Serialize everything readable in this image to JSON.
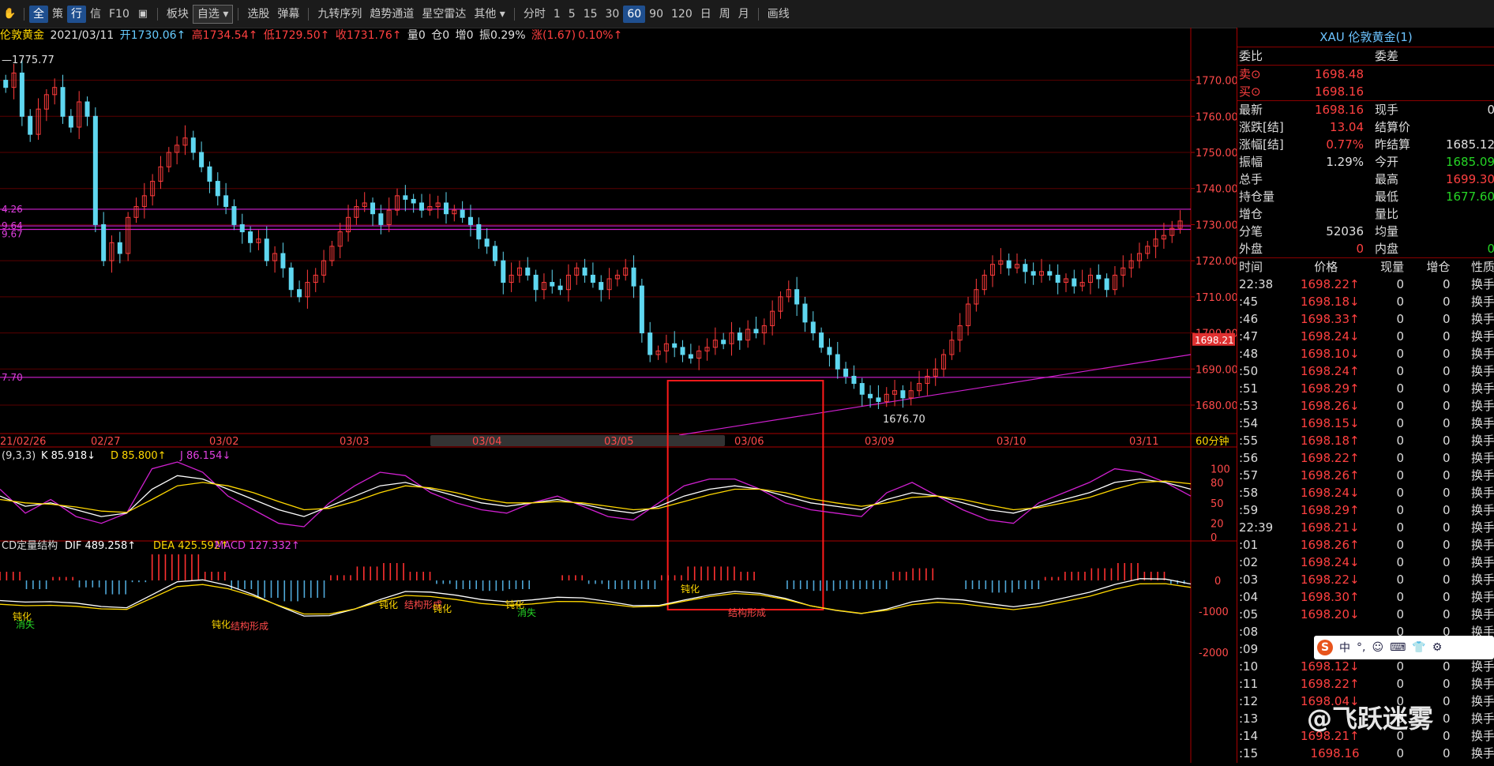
{
  "toolbar": {
    "items": [
      "全",
      "策",
      "行",
      "信",
      "F10",
      "板块",
      "自选",
      "选股",
      "弹幕",
      "九转序列",
      "趋势通道",
      "星空雷达",
      "其他",
      "分时",
      "1",
      "5",
      "15",
      "30",
      "60",
      "90",
      "120",
      "日",
      "周",
      "月",
      "画线"
    ]
  },
  "info": {
    "name": "伦敦黄金",
    "date": "2021/03/11",
    "open": "开1730.06↑",
    "high": "高1734.54↑",
    "low": "低1729.50↑",
    "close": "收1731.76↑",
    "vol": "量0",
    "pos": "仓0",
    "inc": "增0",
    "amp": "振0.29%",
    "chg": "涨(1.67)",
    "chgpct": "0.10%↑"
  },
  "main_chart": {
    "high_label": "1775.77",
    "low_label": "1676.70",
    "price_tag": "1698.21",
    "period_label": "60分钟",
    "y_ticks": [
      "1770.00",
      "1760.00",
      "1750.00",
      "1740.00",
      "1730.00",
      "1720.00",
      "1710.00",
      "1700.00",
      "1690.00",
      "1680.00"
    ],
    "x_dates": [
      "21/02/26",
      "02/27",
      "03/02",
      "03/03",
      "03/04",
      "03/05",
      "03/06",
      "03/09",
      "03/10",
      "03/11"
    ],
    "left_labels": [
      "4.26",
      "9.64",
      "9.67",
      "7.70"
    ],
    "candles": [
      1768,
      1772,
      1760,
      1755,
      1762,
      1766,
      1768,
      1760,
      1757,
      1764,
      1760,
      1730,
      1720,
      1725,
      1722,
      1732,
      1735,
      1738,
      1742,
      1746,
      1750,
      1752,
      1754,
      1750,
      1746,
      1742,
      1738,
      1735,
      1730,
      1728,
      1725,
      1726,
      1720,
      1722,
      1718,
      1712,
      1710,
      1714,
      1716,
      1720,
      1724,
      1728,
      1732,
      1735,
      1736,
      1733,
      1730,
      1734,
      1738,
      1737,
      1736,
      1734,
      1735,
      1736,
      1733,
      1734,
      1732,
      1730,
      1726,
      1724,
      1720,
      1714,
      1716,
      1718,
      1716,
      1712,
      1714,
      1713,
      1712,
      1716,
      1718,
      1716,
      1714,
      1712,
      1715,
      1716,
      1718,
      1713,
      1700,
      1694,
      1695,
      1697,
      1696,
      1694,
      1693,
      1695,
      1696,
      1698,
      1697,
      1700,
      1698,
      1701,
      1700,
      1702,
      1706,
      1710,
      1712,
      1708,
      1703,
      1700,
      1696,
      1694,
      1690,
      1688,
      1686,
      1683,
      1682,
      1681,
      1683,
      1684,
      1682,
      1684,
      1686,
      1688,
      1690,
      1694,
      1698,
      1702,
      1708,
      1712,
      1716,
      1719,
      1720,
      1718,
      1719,
      1717,
      1716,
      1717,
      1716,
      1714,
      1715,
      1713,
      1714,
      1716,
      1715,
      1712,
      1716,
      1718,
      1720,
      1722,
      1724,
      1726,
      1727,
      1729,
      1731
    ],
    "support_line": [
      1680,
      1694
    ],
    "h_lines": [
      1734.26,
      1729.64,
      1728.67,
      1687.7
    ],
    "box": {
      "x0": 0.54,
      "x1": 0.665
    }
  },
  "kdj": {
    "label": "(9,3,3)",
    "k": "K 85.918↓",
    "d": "D 85.800↑",
    "j": "J 86.154↓",
    "y_ticks": [
      "100",
      "80",
      "50",
      "20",
      "0"
    ],
    "k_vals": [
      60,
      45,
      50,
      40,
      30,
      35,
      70,
      90,
      85,
      70,
      55,
      40,
      30,
      45,
      60,
      75,
      80,
      70,
      60,
      50,
      45,
      50,
      55,
      48,
      40,
      35,
      45,
      60,
      70,
      75,
      70,
      60,
      50,
      45,
      40,
      55,
      65,
      60,
      50,
      40,
      35,
      45,
      55,
      65,
      80,
      85,
      80,
      70
    ],
    "d_vals": [
      55,
      50,
      48,
      44,
      38,
      36,
      55,
      75,
      80,
      75,
      65,
      52,
      40,
      42,
      52,
      65,
      75,
      72,
      65,
      56,
      50,
      50,
      52,
      50,
      45,
      40,
      42,
      52,
      62,
      70,
      70,
      65,
      56,
      50,
      45,
      50,
      58,
      60,
      55,
      47,
      40,
      43,
      50,
      58,
      70,
      80,
      82,
      78
    ],
    "j_vals": [
      70,
      35,
      55,
      30,
      20,
      35,
      100,
      110,
      95,
      60,
      40,
      20,
      15,
      50,
      75,
      95,
      90,
      65,
      50,
      40,
      35,
      50,
      60,
      45,
      30,
      25,
      50,
      75,
      85,
      85,
      70,
      50,
      40,
      35,
      30,
      65,
      80,
      60,
      40,
      25,
      20,
      50,
      65,
      80,
      100,
      95,
      80,
      60
    ]
  },
  "macd": {
    "label": "CD定量结构",
    "dif": "DIF 489.258↑",
    "dea": "DEA 425.592↑",
    "macd": "MACD 127.332↑",
    "y_ticks": [
      "0",
      "-1000",
      "-2000"
    ],
    "annotations": [
      "钝化",
      "消失",
      "钝化",
      "结构形成",
      "钝化",
      "结构形成",
      "钝化",
      "钝化",
      "消失",
      "钝化",
      "结构形成"
    ]
  },
  "quote": {
    "title": "XAU 伦敦黄金(1)",
    "wei_bi": "委比",
    "wei_cha": "委差",
    "sell_label": "卖⊙",
    "sell_price": "1698.48",
    "buy_label": "买⊙",
    "buy_price": "1698.16",
    "rows": [
      {
        "l1": "最新",
        "v1": "1698.16",
        "c1": "red",
        "l2": "现手",
        "v2": "0",
        "c2": "white"
      },
      {
        "l1": "涨跌[结]",
        "v1": "13.04",
        "c1": "red",
        "l2": "结算价",
        "v2": "",
        "c2": "white"
      },
      {
        "l1": "涨幅[结]",
        "v1": "0.77%",
        "c1": "red",
        "l2": "昨结算",
        "v2": "1685.12",
        "c2": "white"
      },
      {
        "l1": "振幅",
        "v1": "1.29%",
        "c1": "white",
        "l2": "今开",
        "v2": "1685.09",
        "c2": "green"
      },
      {
        "l1": "总手",
        "v1": "",
        "c1": "white",
        "l2": "最高",
        "v2": "1699.30",
        "c2": "red"
      },
      {
        "l1": "持仓量",
        "v1": "",
        "c1": "white",
        "l2": "最低",
        "v2": "1677.60",
        "c2": "green"
      },
      {
        "l1": "增仓",
        "v1": "",
        "c1": "white",
        "l2": "量比",
        "v2": "",
        "c2": "white"
      },
      {
        "l1": "分笔",
        "v1": "52036",
        "c1": "white",
        "l2": "均量",
        "v2": "",
        "c2": "white"
      },
      {
        "l1": "外盘",
        "v1": "0",
        "c1": "red",
        "l2": "内盘",
        "v2": "0",
        "c2": "green"
      }
    ]
  },
  "ticks": {
    "headers": [
      "时间",
      "价格",
      "现量",
      "增仓",
      "性质"
    ],
    "rows": [
      {
        "t": "22:38",
        "p": "1698.22↑",
        "pc": "red",
        "q": "0",
        "z": "0",
        "x": "换手"
      },
      {
        "t": ":45",
        "p": "1698.18↓",
        "pc": "red",
        "q": "0",
        "z": "0",
        "x": "换手"
      },
      {
        "t": ":46",
        "p": "1698.33↑",
        "pc": "red",
        "q": "0",
        "z": "0",
        "x": "换手"
      },
      {
        "t": ":47",
        "p": "1698.24↓",
        "pc": "red",
        "q": "0",
        "z": "0",
        "x": "换手"
      },
      {
        "t": ":48",
        "p": "1698.10↓",
        "pc": "red",
        "q": "0",
        "z": "0",
        "x": "换手"
      },
      {
        "t": ":50",
        "p": "1698.24↑",
        "pc": "red",
        "q": "0",
        "z": "0",
        "x": "换手"
      },
      {
        "t": ":51",
        "p": "1698.29↑",
        "pc": "red",
        "q": "0",
        "z": "0",
        "x": "换手"
      },
      {
        "t": ":53",
        "p": "1698.26↓",
        "pc": "red",
        "q": "0",
        "z": "0",
        "x": "换手"
      },
      {
        "t": ":54",
        "p": "1698.15↓",
        "pc": "red",
        "q": "0",
        "z": "0",
        "x": "换手"
      },
      {
        "t": ":55",
        "p": "1698.18↑",
        "pc": "red",
        "q": "0",
        "z": "0",
        "x": "换手"
      },
      {
        "t": ":56",
        "p": "1698.22↑",
        "pc": "red",
        "q": "0",
        "z": "0",
        "x": "换手"
      },
      {
        "t": ":57",
        "p": "1698.26↑",
        "pc": "red",
        "q": "0",
        "z": "0",
        "x": "换手"
      },
      {
        "t": ":58",
        "p": "1698.24↓",
        "pc": "red",
        "q": "0",
        "z": "0",
        "x": "换手"
      },
      {
        "t": ":59",
        "p": "1698.29↑",
        "pc": "red",
        "q": "0",
        "z": "0",
        "x": "换手"
      },
      {
        "t": "22:39",
        "p": "1698.21↓",
        "pc": "red",
        "q": "0",
        "z": "0",
        "x": "换手"
      },
      {
        "t": ":01",
        "p": "1698.26↑",
        "pc": "red",
        "q": "0",
        "z": "0",
        "x": "换手"
      },
      {
        "t": ":02",
        "p": "1698.24↓",
        "pc": "red",
        "q": "0",
        "z": "0",
        "x": "换手"
      },
      {
        "t": ":03",
        "p": "1698.22↓",
        "pc": "red",
        "q": "0",
        "z": "0",
        "x": "换手"
      },
      {
        "t": ":04",
        "p": "1698.30↑",
        "pc": "red",
        "q": "0",
        "z": "0",
        "x": "换手"
      },
      {
        "t": ":05",
        "p": "1698.20↓",
        "pc": "red",
        "q": "0",
        "z": "0",
        "x": "换手"
      },
      {
        "t": ":08",
        "p": "",
        "pc": "red",
        "q": "0",
        "z": "0",
        "x": "换手"
      },
      {
        "t": ":09",
        "p": "",
        "pc": "red",
        "q": "0",
        "z": "0",
        "x": "换手"
      },
      {
        "t": ":10",
        "p": "1698.12↓",
        "pc": "red",
        "q": "0",
        "z": "0",
        "x": "换手"
      },
      {
        "t": ":11",
        "p": "1698.22↑",
        "pc": "red",
        "q": "0",
        "z": "0",
        "x": "换手"
      },
      {
        "t": ":12",
        "p": "1698.04↓",
        "pc": "red",
        "q": "0",
        "z": "0",
        "x": "换手"
      },
      {
        "t": ":13",
        "p": "",
        "pc": "red",
        "q": "0",
        "z": "0",
        "x": "换手"
      },
      {
        "t": ":14",
        "p": "1698.21↑",
        "pc": "red",
        "q": "0",
        "z": "0",
        "x": "换手"
      },
      {
        "t": ":15",
        "p": "1698.16",
        "pc": "red",
        "q": "0",
        "z": "0",
        "x": "换手"
      }
    ]
  },
  "ime": {
    "items": [
      "S",
      "中",
      "°,",
      "☺",
      "⌨",
      "👕",
      "⚙"
    ]
  },
  "watermark": "@飞跃迷雾"
}
